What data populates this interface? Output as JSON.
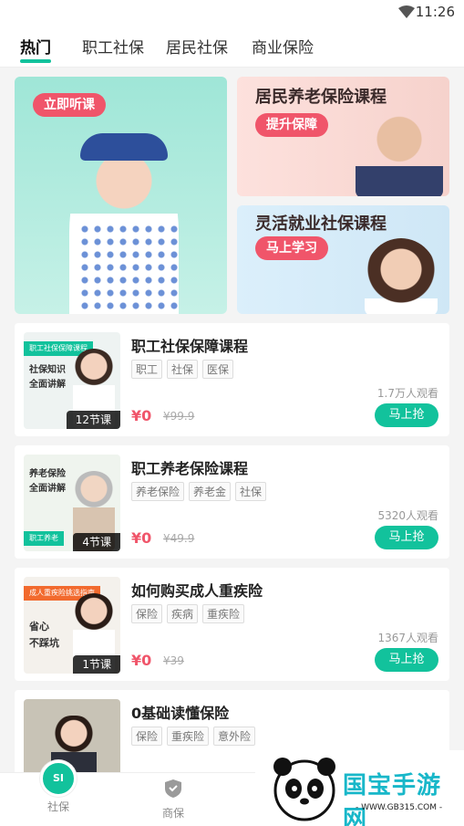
{
  "status_bar": {
    "time": "11:26",
    "wifi_icon": "wifi-icon"
  },
  "tabs": [
    {
      "label": "热门",
      "active": true
    },
    {
      "label": "职工社保",
      "active": false
    },
    {
      "label": "居民社保",
      "active": false
    },
    {
      "label": "商业保险",
      "active": false
    }
  ],
  "banners": {
    "left": {
      "button": "立即听课"
    },
    "right_top": {
      "title": "居民养老保险课程",
      "button": "提升保障"
    },
    "right_bottom": {
      "title": "灵活就业社保课程",
      "button": "马上学习"
    }
  },
  "courses": [
    {
      "title": "职工社保保障课程",
      "tags": [
        "职工",
        "社保",
        "医保"
      ],
      "views": "1.7万人观看",
      "price": "¥0",
      "original_price": "¥99.9",
      "button": "马上抢",
      "lessons": "12节课",
      "thumb_tag": "职工社保保障课程",
      "thumb_lines": [
        "社保知识",
        "全面讲解"
      ]
    },
    {
      "title": "职工养老保险课程",
      "tags": [
        "养老保险",
        "养老金",
        "社保"
      ],
      "views": "5320人观看",
      "price": "¥0",
      "original_price": "¥49.9",
      "button": "马上抢",
      "lessons": "4节课",
      "thumb_tag": "职工养老",
      "thumb_lines": [
        "养老保险",
        "全面讲解"
      ]
    },
    {
      "title": "如何购买成人重疾险",
      "tags": [
        "保险",
        "疾病",
        "重疾险"
      ],
      "views": "1367人观看",
      "price": "¥0",
      "original_price": "¥39",
      "button": "马上抢",
      "lessons": "1节课",
      "thumb_tag": "成人重疾险挑选指南",
      "thumb_lines": [
        "省心",
        "不踩坑"
      ]
    },
    {
      "title": "0基础读懂保险",
      "tags": [
        "保险",
        "重疾险",
        "意外险"
      ]
    }
  ],
  "bottom_nav": [
    {
      "label": "社保",
      "icon": "shield-si-icon",
      "active": true
    },
    {
      "label": "商保",
      "icon": "shield-check-icon",
      "active": false
    }
  ],
  "watermark": {
    "text": "国宝手游网",
    "url": "- WWW.GB315.COM -"
  },
  "colors": {
    "accent": "#12c29c",
    "price": "#f0556a"
  }
}
